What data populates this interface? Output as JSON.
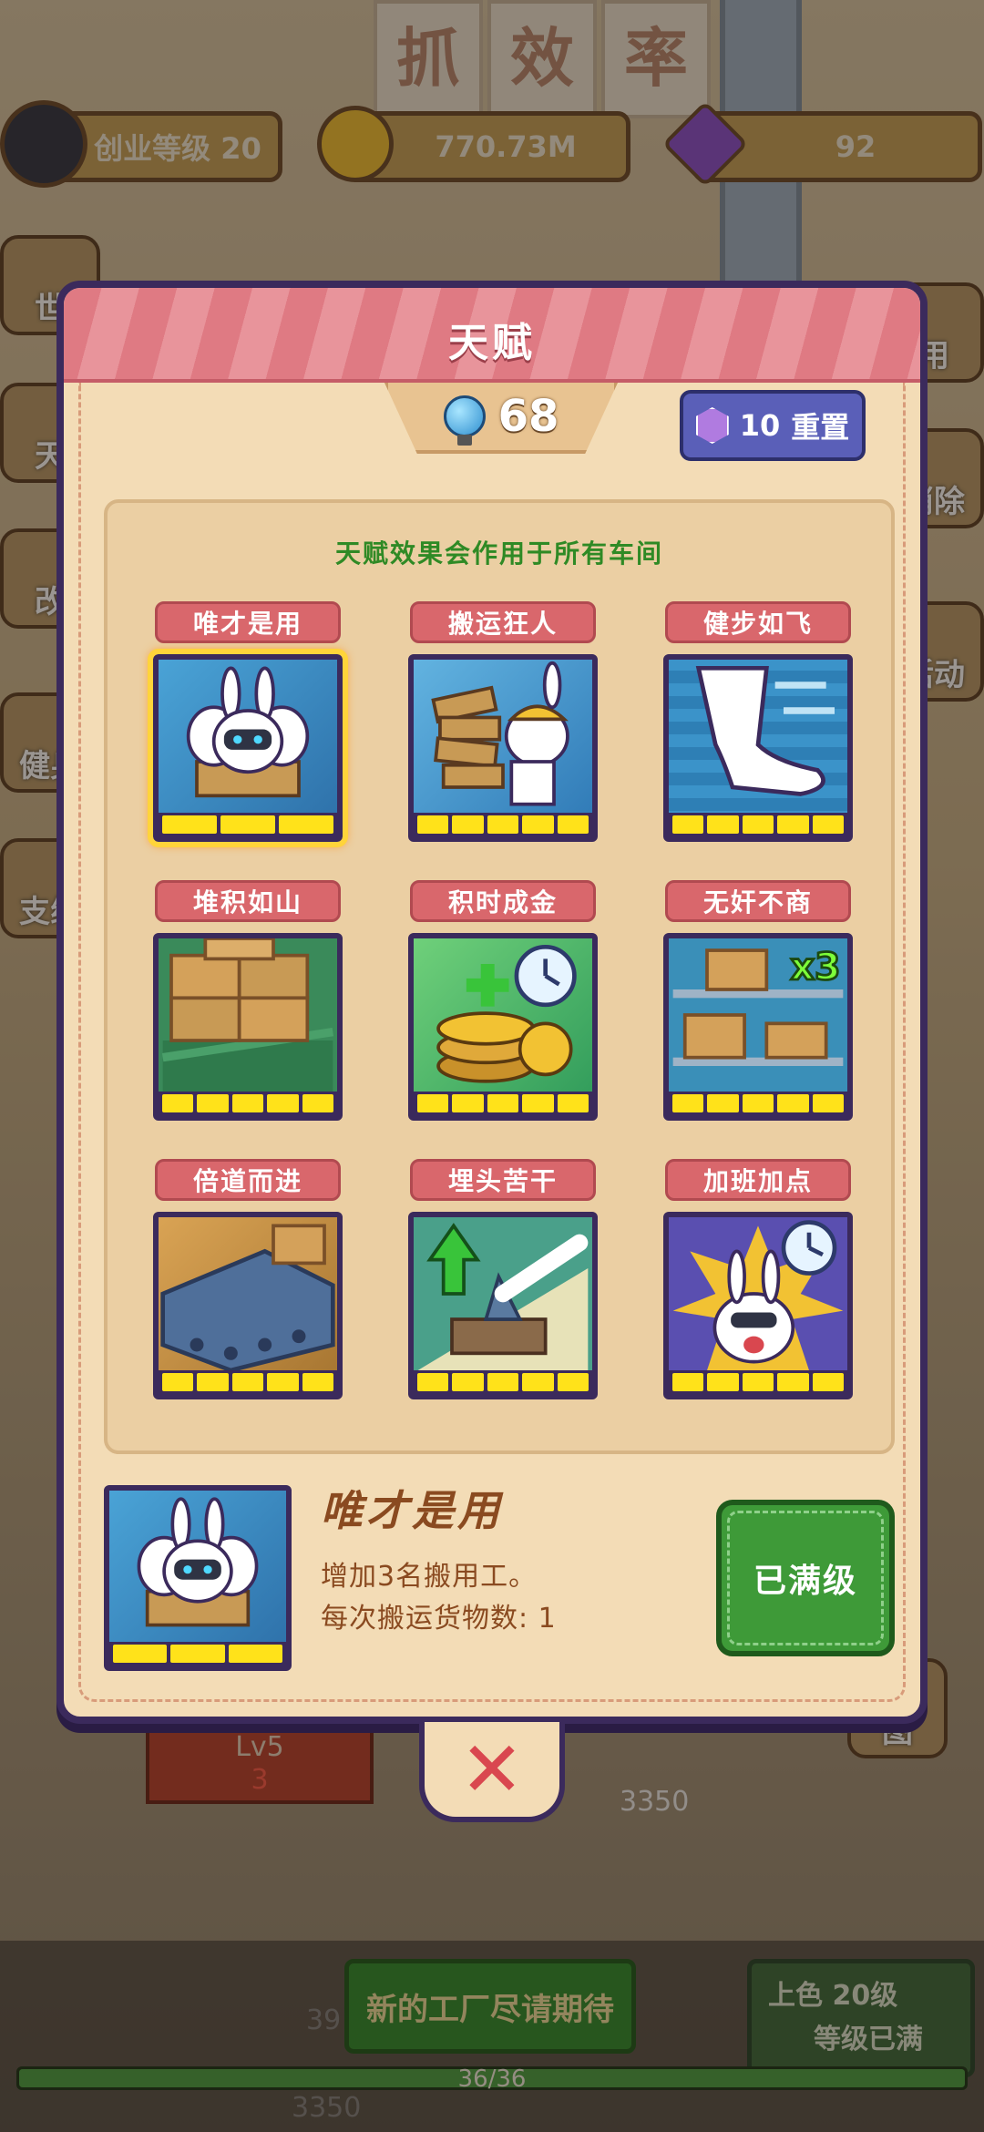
{
  "hud": {
    "startup_level_label": "创业等级 20",
    "coins": "770.73M",
    "gems": "92"
  },
  "background": {
    "banner_chars": [
      "抓",
      "效",
      "率"
    ],
    "side_left": [
      "世",
      "天",
      "改",
      "健身",
      "支线"
    ],
    "side_right": [
      "用",
      "消除",
      "活动",
      "图"
    ],
    "level_tag": "Lv5",
    "level_sub": "3",
    "counter": "3350",
    "counter2": "39",
    "counter3": "3350",
    "new_factory_label": "新的工厂尽请期待",
    "upgrade_title": "上色 20级",
    "upgrade_status": "等级已满",
    "progress_text": "36/36",
    "progress": 1.0
  },
  "modal": {
    "title": "天赋",
    "points": "68",
    "reset_cost": "10",
    "reset_label": "重置",
    "panel_note": "天赋效果会作用于所有车间",
    "talents": [
      {
        "name": "唯才是用",
        "art": "rabbit-robot",
        "level": 3,
        "max": 3,
        "selected": true
      },
      {
        "name": "搬运狂人",
        "art": "rabbit-carrying-boxes",
        "level": 5,
        "max": 5
      },
      {
        "name": "健步如飞",
        "art": "running-leg",
        "level": 5,
        "max": 5
      },
      {
        "name": "堆积如山",
        "art": "stacked-boxes",
        "level": 5,
        "max": 5
      },
      {
        "name": "积时成金",
        "art": "coins-clock",
        "level": 5,
        "max": 5
      },
      {
        "name": "无奸不商",
        "art": "shelf-boxes-x3",
        "level": 5,
        "max": 5
      },
      {
        "name": "倍道而进",
        "art": "conveyor-belt",
        "level": 5,
        "max": 5
      },
      {
        "name": "埋头苦干",
        "art": "lever-upgrade",
        "level": 5,
        "max": 5
      },
      {
        "name": "加班加点",
        "art": "rabbit-clock",
        "level": 5,
        "max": 5
      }
    ],
    "badge_text": "x3",
    "detail": {
      "name": "唯才是用",
      "line1": "增加3名搬用工。",
      "line2": "每次搬运货物数: 1",
      "level": 3,
      "max": 3
    },
    "maxed_label": "已满级",
    "close_glyph": "✕"
  }
}
